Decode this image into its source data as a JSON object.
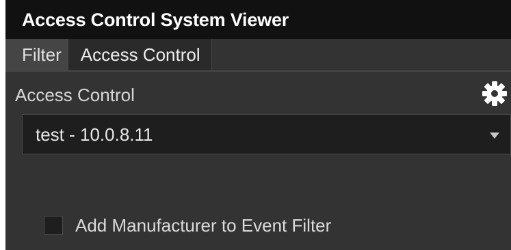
{
  "window": {
    "title": "Access Control System Viewer"
  },
  "tabs": [
    {
      "label": "Filter",
      "active": true
    },
    {
      "label": "Access Control",
      "active": false
    }
  ],
  "panel": {
    "section_label": "Access Control",
    "settings_icon": "gear-icon",
    "select": {
      "value": "test - 10.0.8.11"
    },
    "checkbox": {
      "label": "Add Manufacturer to Event Filter",
      "checked": false
    }
  },
  "colors": {
    "titlebar_bg": "#111111",
    "panel_bg": "#333333",
    "active_tab_bg": "#454545",
    "inactive_tab_bg": "#2a2a2a",
    "input_bg": "#1e1e1e",
    "text": "#e8e8e8"
  }
}
